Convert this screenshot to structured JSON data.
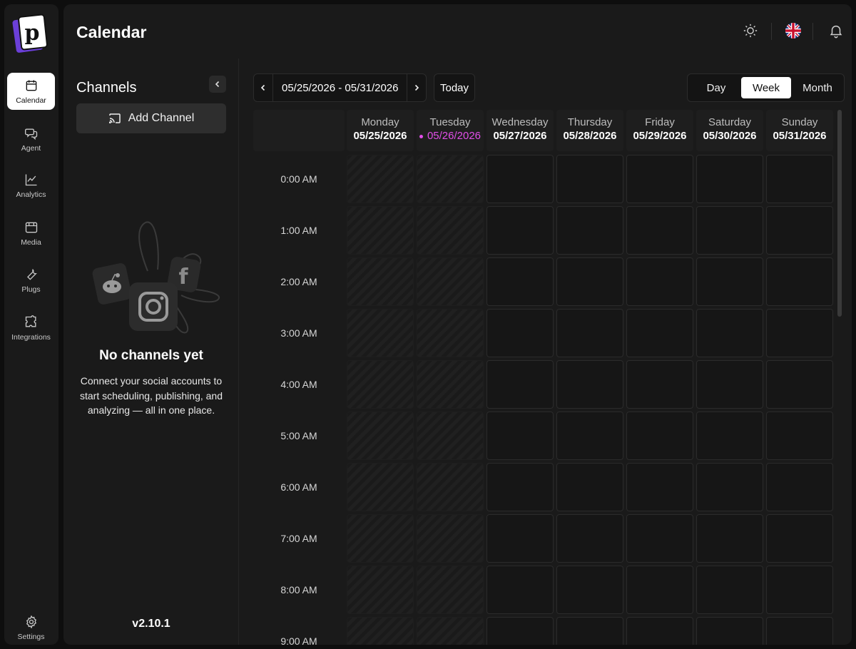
{
  "app": {
    "logo_letter": "p",
    "nav": [
      {
        "label": "Calendar",
        "icon": "calendar-icon",
        "active": true
      },
      {
        "label": "Agent",
        "icon": "chat-icon"
      },
      {
        "label": "Analytics",
        "icon": "chart-line-icon"
      },
      {
        "label": "Media",
        "icon": "media-icon"
      },
      {
        "label": "Plugs",
        "icon": "wrench-icon"
      },
      {
        "label": "Integrations",
        "icon": "puzzle-icon"
      }
    ],
    "settings_label": "Settings"
  },
  "header": {
    "title": "Calendar",
    "icons": [
      "sun-icon",
      "uk-flag-icon",
      "bell-icon"
    ]
  },
  "channels": {
    "title": "Channels",
    "add_label": "Add Channel",
    "empty_title": "No channels yet",
    "empty_desc": "Connect your social accounts to start scheduling, publishing, and analyzing — all in one place.",
    "version": "v2.10.1"
  },
  "toolbar": {
    "range": "05/25/2026 - 05/31/2026",
    "today": "Today",
    "views": [
      "Day",
      "Week",
      "Month"
    ],
    "active_view": "Week"
  },
  "calendar": {
    "days": [
      {
        "name": "Monday",
        "date": "05/25/2026",
        "past": true
      },
      {
        "name": "Tuesday",
        "date": "05/26/2026",
        "past": true,
        "today": true
      },
      {
        "name": "Wednesday",
        "date": "05/27/2026"
      },
      {
        "name": "Thursday",
        "date": "05/28/2026"
      },
      {
        "name": "Friday",
        "date": "05/29/2026"
      },
      {
        "name": "Saturday",
        "date": "05/30/2026"
      },
      {
        "name": "Sunday",
        "date": "05/31/2026"
      }
    ],
    "times": [
      "0:00 AM",
      "1:00 AM",
      "2:00 AM",
      "3:00 AM",
      "4:00 AM",
      "5:00 AM",
      "6:00 AM",
      "7:00 AM",
      "8:00 AM",
      "9:00 AM"
    ]
  },
  "colors": {
    "accent": "#e14ee8",
    "logo_purple": "#6b3fd8"
  }
}
